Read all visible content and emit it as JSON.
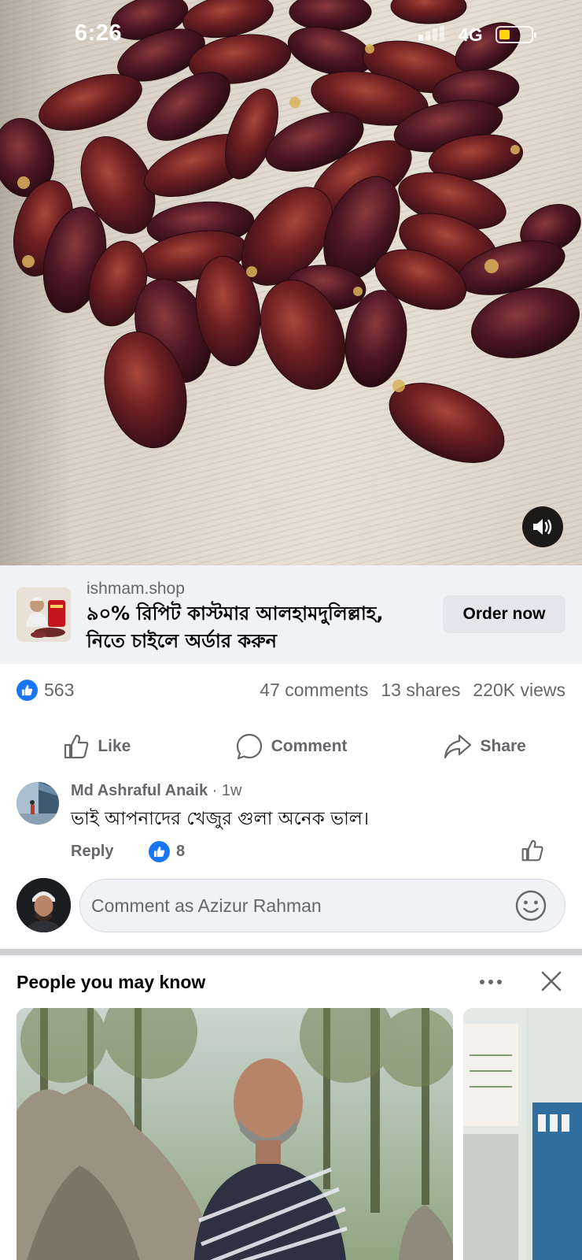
{
  "status_bar": {
    "time": "6:26",
    "network": "4G"
  },
  "video": {
    "mute_icon": "speaker-icon"
  },
  "sponsored": {
    "domain": "ishmam.shop",
    "headline": "৯০% রিপিট কাস্টমার আলহামদুলিল্লাহ, নিতে চাইলে অর্ডার করুন",
    "cta_label": "Order now"
  },
  "engagement": {
    "reactions": "563",
    "comments": "47 comments",
    "shares": "13 shares",
    "views": "220K views"
  },
  "actions": {
    "like": "Like",
    "comment": "Comment",
    "share": "Share"
  },
  "top_comment": {
    "author": "Md Ashraful Anaik",
    "time": " · 1w",
    "text": "ভাই আপনাদের খেজুর গুলা অনেক ভাল।",
    "reply_label": "Reply",
    "like_count": "8"
  },
  "composer": {
    "placeholder": "Comment as Azizur Rahman"
  },
  "pymk": {
    "title": "People you may know"
  },
  "colors": {
    "brand_blue": "#1877f2",
    "secondary_text": "#65676b",
    "cta_bg": "#f0f2f5"
  }
}
